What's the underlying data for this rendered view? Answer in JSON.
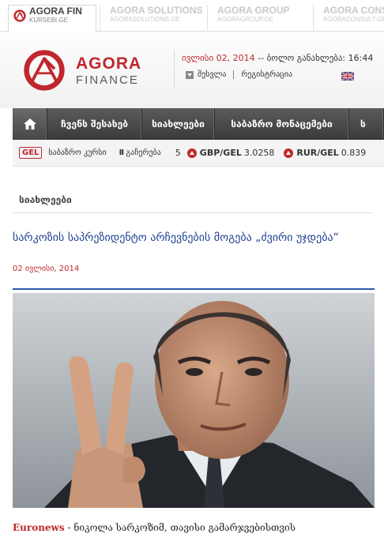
{
  "sister_sites": [
    {
      "name": "AGORA FIN",
      "url": "KURSEBI.GE"
    },
    {
      "name": "AGORA SOLUTIONS",
      "url": "AGORASOLUTIONS.GE"
    },
    {
      "name": "AGORA GROUP",
      "url": "AGORAGROUP.GE"
    },
    {
      "name": "AGORA CONSU",
      "url": "AGORACONSULT.GE"
    }
  ],
  "brand": {
    "line1": "AGORA",
    "line2": "FINANCE"
  },
  "header": {
    "date": "ივლისი 02, 2014",
    "updated_label": "-- ბოლო განახლება:",
    "updated_time": "16:44",
    "login": "შესვლა",
    "register": "რეგისტრაცია"
  },
  "nav": {
    "items": [
      "ჩვენს შესახებ",
      "სიახლეები",
      "საბაზრო მონაცემები",
      "ს"
    ]
  },
  "ticker": {
    "currency_badge": "GEL",
    "title": "საბაზრო კურსი",
    "pause_label": "II",
    "pause_text": "გაჩერება",
    "page_num": "5",
    "rates": [
      {
        "pair": "GBP/GEL",
        "value": "3.0258"
      },
      {
        "pair": "RUR/GEL",
        "value": "0.839"
      }
    ]
  },
  "content": {
    "section_title": "სიახლეები",
    "headline": "სარკოზის საპრეზიდენტო არჩევნების მოგება „ძვირი უჯდება“",
    "pub_date": "02 ივლისი, 2014",
    "source": "Euronews",
    "lead": " - ნიკოლა სარკოზიმ, თავისი გამარჯვებისთვის"
  },
  "colors": {
    "accent": "#c0272d",
    "link": "#1d3f8f",
    "nav_bg": "#4a4a4a"
  }
}
